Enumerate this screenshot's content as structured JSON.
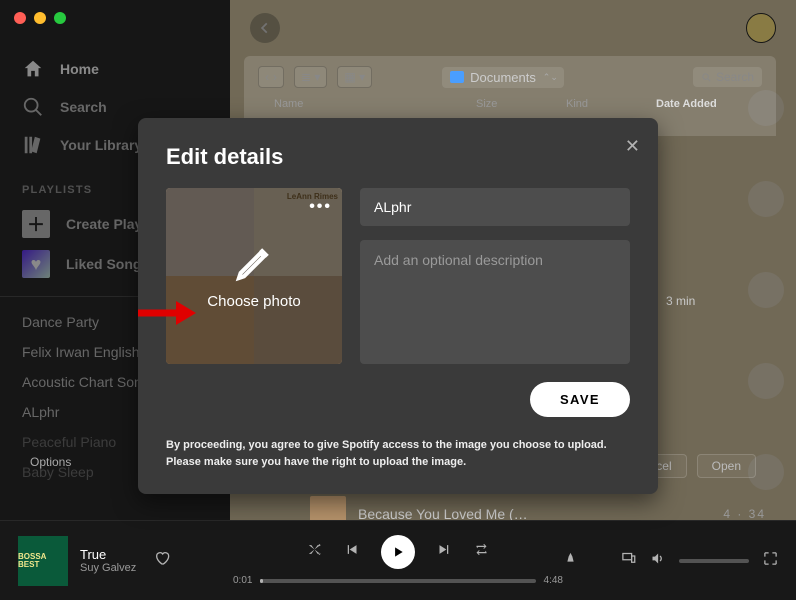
{
  "sidebar": {
    "home": "Home",
    "search": "Search",
    "library": "Your Library",
    "section_label": "PLAYLISTS",
    "create": "Create Playlist",
    "liked": "Liked Songs",
    "playlists": [
      "Dance Party",
      "Felix Irwan English",
      "Acoustic Chart Songs",
      "ALphr",
      "Peaceful Piano",
      "Baby Sleep"
    ]
  },
  "picker": {
    "back": "‹",
    "forward": "›",
    "folder_label": "Documents",
    "search_placeholder": "Search",
    "col_name": "Name",
    "col_size": "Size",
    "col_kind": "Kind",
    "col_date": "Date Added",
    "options": "Options",
    "cancel": "Cancel",
    "open": "Open"
  },
  "modal": {
    "title": "Edit details",
    "choose": "Choose photo",
    "dots": "•••",
    "name_value": "ALphr",
    "desc_placeholder": "Add an optional description",
    "save": "SAVE",
    "legal": "By proceeding, you agree to give Spotify access to the image you choose to upload. Please make sure you have the right to upload the image."
  },
  "context": {
    "duration_hint": "3 min"
  },
  "queue": {
    "title": "Because You Loved Me (…",
    "duration": "4 · 34"
  },
  "player": {
    "track": "True",
    "artist": "Suy Galvez",
    "album_text": "BOSSA BEST",
    "elapsed": "0:01",
    "total": "4:48"
  }
}
